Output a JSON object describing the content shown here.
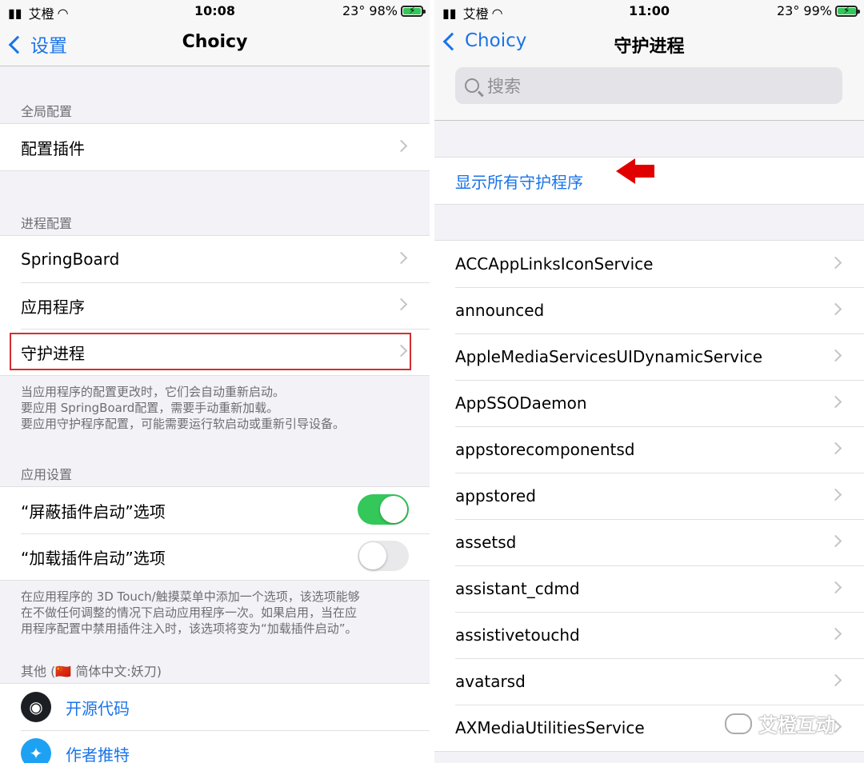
{
  "left": {
    "status": {
      "carrier": "艾橙",
      "time": "10:08",
      "temp_battery": "23° 98%"
    },
    "nav": {
      "back_label": "设置",
      "title": "Choicy"
    },
    "sections": {
      "global": {
        "header": "全局配置",
        "items": [
          "配置插件"
        ]
      },
      "process": {
        "header": "进程配置",
        "items": [
          "SpringBoard",
          "应用程序",
          "守护进程"
        ],
        "footer": [
          "当应用程序的配置更改时，它们会自动重新启动。",
          "要应用 SpringBoard配置，需要手动重新加载。",
          "要应用守护程序配置，可能需要运行软启动或重新引导设备。"
        ]
      },
      "app_settings": {
        "header": "应用设置",
        "toggles": [
          {
            "label": "“屏蔽插件启动”选项",
            "on": true
          },
          {
            "label": "“加载插件启动”选项",
            "on": false
          }
        ],
        "footer": [
          "在应用程序的 3D Touch/触摸菜单中添加一个选项，该选项能够",
          "在不做任何调整的情况下启动应用程序一次。如果启用，当在应",
          "用程序配置中禁用插件注入时，该选项将变为“加载插件启动”。"
        ]
      },
      "other": {
        "header": "其他 (🇨🇳 简体中文:妖刀)",
        "links": [
          {
            "label": "开源代码",
            "icon": "github-icon"
          },
          {
            "label": "作者推特",
            "icon": "twitter-icon"
          }
        ]
      }
    }
  },
  "right": {
    "status": {
      "carrier": "艾橙",
      "time": "11:00",
      "temp_battery": "23° 99%"
    },
    "nav": {
      "back_label": "Choicy",
      "title": "守护进程"
    },
    "search": {
      "placeholder": "搜索"
    },
    "show_all": "显示所有守护程序",
    "daemons": [
      "ACCAppLinksIconService",
      "announced",
      "AppleMediaServicesUIDynamicService",
      "AppSSODaemon",
      "appstorecomponentsd",
      "appstored",
      "assetsd",
      "assistant_cdmd",
      "assistivetouchd",
      "avatarsd",
      "AXMediaUtilitiesService"
    ]
  },
  "watermark": "艾橙互动",
  "colors": {
    "accent": "#1a74e8",
    "toggle_on": "#34c759",
    "highlight": "#d62d2d",
    "arrow": "#e10000"
  }
}
